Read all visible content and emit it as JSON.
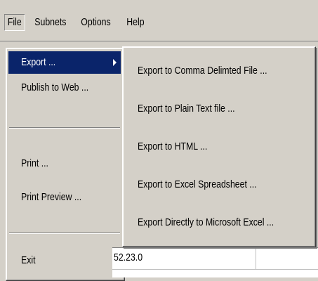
{
  "menubar": {
    "items": [
      {
        "label": "File"
      },
      {
        "label": "Subnets"
      },
      {
        "label": "Options"
      },
      {
        "label": "Help"
      }
    ]
  },
  "file_menu": {
    "export_label": "Export ...",
    "publish_label": "Publish to Web ...",
    "print_label": "Print ...",
    "print_preview_label": "Print Preview ...",
    "exit_label": "Exit"
  },
  "export_submenu": {
    "items": [
      {
        "label": "Export to Comma Delimted File ..."
      },
      {
        "label": "Export to Plain Text file ..."
      },
      {
        "label": "Export to HTML ..."
      },
      {
        "label": "Export to Excel Spreadsheet ..."
      },
      {
        "label": "Export Directly to Microsoft Excel ..."
      }
    ]
  },
  "grid": {
    "cell_value": "52.23.0"
  },
  "colors": {
    "menu_bg": "#d4d0c8",
    "highlight": "#0a246a",
    "highlight_text": "#ffffff"
  }
}
